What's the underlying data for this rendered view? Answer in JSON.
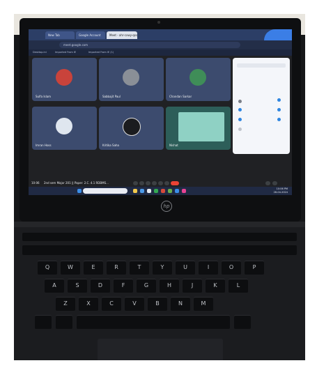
{
  "browser": {
    "tabs": [
      {
        "label": "New Tab"
      },
      {
        "label": "Google Account"
      },
      {
        "label": "Meet - ahr-cxwy-qss"
      }
    ],
    "url": "meet.google.com",
    "bookmarks": [
      "Desktop.ini",
      "Imported From IE",
      "Imported From IE (1)"
    ]
  },
  "meet": {
    "participants": [
      {
        "name": "Sulfa Islam",
        "color": "#c9433b"
      },
      {
        "name": "Sabbajit Paul",
        "color": "#8a8f97"
      },
      {
        "name": "Chandan Sarkar",
        "color": "#3f8d58"
      },
      {
        "name": "Imran Hoss",
        "color": "#dfe6ef"
      },
      {
        "name": "Kritika Saha",
        "color": "#1b1c1f"
      },
      {
        "name": "Nishat",
        "color": "#59b0a0"
      }
    ],
    "time": "10:06",
    "meeting_title": "2nd sem Major 201 || Paper: 2.C. 4.1 RDBMS..."
  },
  "taskbar": {
    "clock_time": "10:06 PM",
    "clock_date": "26-04-2024"
  },
  "laptop": {
    "logo": "hp"
  },
  "keyboard": {
    "row1": [
      "Q",
      "W",
      "E",
      "R",
      "T",
      "Y",
      "U",
      "I",
      "O",
      "P"
    ],
    "row2": [
      "A",
      "S",
      "D",
      "F",
      "G",
      "H",
      "J",
      "K",
      "L"
    ],
    "row3": [
      "Z",
      "X",
      "C",
      "V",
      "B",
      "N",
      "M"
    ]
  }
}
